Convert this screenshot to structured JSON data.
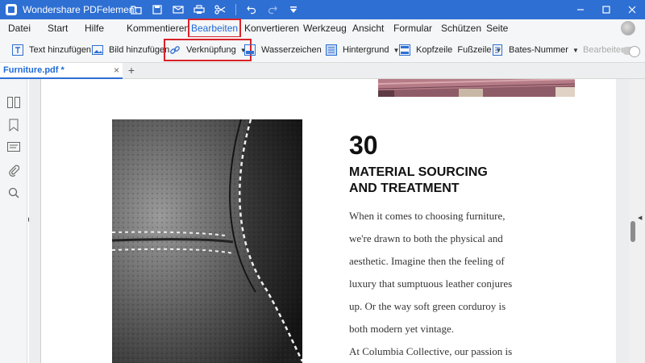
{
  "app": {
    "title": "Wondershare PDFelement"
  },
  "quick_access": [
    "folder-icon",
    "save-icon",
    "mail-icon",
    "print-icon",
    "scissors-icon",
    "undo-icon",
    "redo-icon",
    "dropdown-icon"
  ],
  "menu": {
    "items": [
      "Datei",
      "Start",
      "Hilfe",
      "Kommentieren",
      "Bearbeiten",
      "Konvertieren",
      "Werkzeug",
      "Ansicht",
      "Formular",
      "Schützen",
      "Seite"
    ],
    "active": "Bearbeiten"
  },
  "toolbar": {
    "text_add": "Text hinzufügen",
    "image_add": "Bild hinzufügen",
    "link": "Verknüpfung",
    "watermark": "Wasserzeichen",
    "background": "Hintergrund",
    "header_footer": "Kopfzeile  Fußzeile",
    "bates": "Bates-Nummer",
    "edit": "Bearbeiten"
  },
  "tabs": {
    "document": "Furniture.pdf *",
    "close": "×",
    "new": "+"
  },
  "document": {
    "number": "30",
    "heading_line1": "MATERIAL SOURCING",
    "heading_line2": "AND TREATMENT",
    "body": [
      "When it comes to choosing furniture,",
      "we're drawn to both the physical and",
      "aesthetic. Imagine then the feeling of",
      "luxury that sumptuous leather conjures",
      "up. Or the way soft green corduroy is",
      "both modern yet vintage.",
      "At Columbia Collective, our passion is"
    ]
  },
  "colors": {
    "titlebar": "#2e6fd3",
    "accent": "#1e6ad6",
    "highlight": "#d9222a"
  }
}
